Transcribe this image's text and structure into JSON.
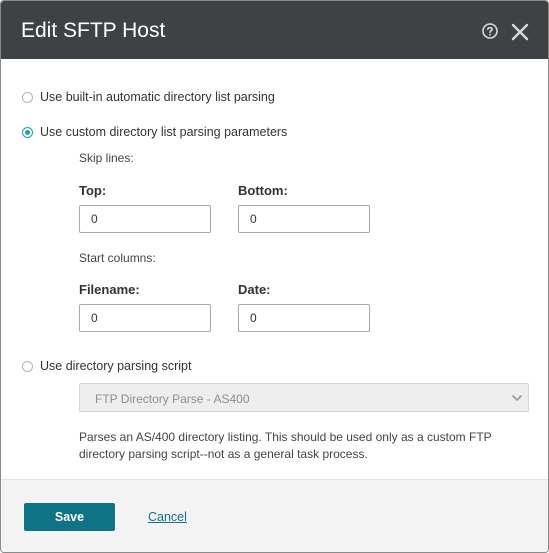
{
  "dialog": {
    "title": "Edit SFTP Host",
    "help_icon": "help-circle-icon",
    "close_icon": "close-icon"
  },
  "options": {
    "builtin_label": "Use built-in automatic directory list parsing",
    "custom_label": "Use custom directory list parsing parameters",
    "script_label": "Use directory parsing script",
    "selected": "custom"
  },
  "custom": {
    "skip_lines_label": "Skip lines:",
    "top_label": "Top:",
    "top_value": "0",
    "bottom_label": "Bottom:",
    "bottom_value": "0",
    "start_columns_label": "Start columns:",
    "filename_label": "Filename:",
    "filename_value": "0",
    "date_label": "Date:",
    "date_value": "0"
  },
  "script": {
    "selected_value": "FTP Directory Parse - AS400",
    "description": "Parses an AS/400 directory listing. This should be used only as a custom FTP directory parsing script--not as a general task process."
  },
  "footer": {
    "save_label": "Save",
    "cancel_label": "Cancel"
  },
  "colors": {
    "header_bg": "#3f4245",
    "accent": "#0e7384",
    "radio_checked": "#1aa0b8"
  }
}
